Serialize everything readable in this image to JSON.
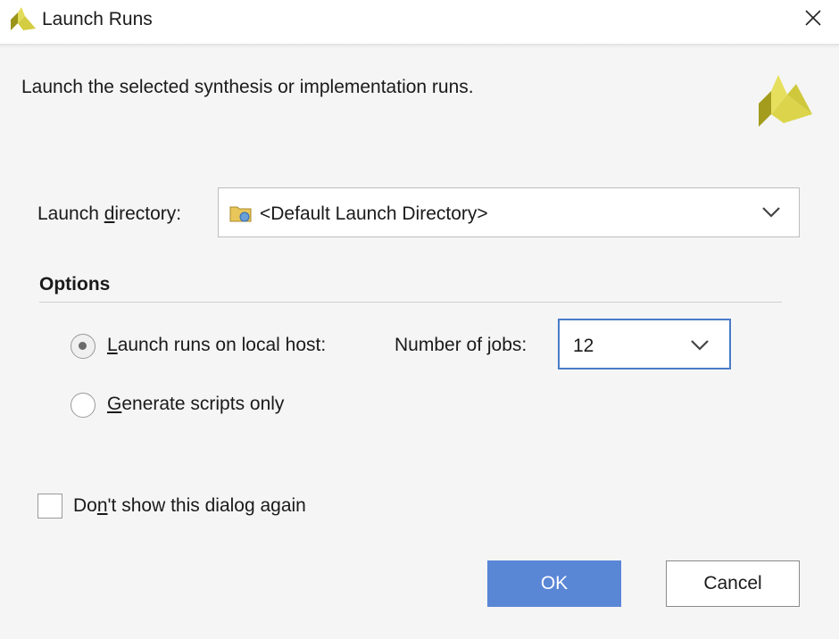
{
  "window": {
    "title": "Launch Runs",
    "close_icon": "close-x"
  },
  "description": "Launch the selected synthesis or implementation runs.",
  "launch_directory": {
    "label_pre": "Launch ",
    "label_mnemonic": "d",
    "label_post": "irectory:",
    "value": "<Default Launch Directory>",
    "icon": "folder-icon"
  },
  "options": {
    "title": "Options",
    "local_host": {
      "label_mnemonic": "L",
      "label_post": "aunch runs on local host:",
      "selected": true
    },
    "scripts_only": {
      "label_mnemonic": "G",
      "label_post": "enerate scripts only",
      "selected": false
    },
    "jobs": {
      "label_pre": "Number of ",
      "label_mnemonic": "j",
      "label_post": "obs:",
      "value": "12"
    }
  },
  "dont_show": {
    "label_pre": "Do",
    "label_mnemonic": "n",
    "label_post": "'t show this dialog again",
    "checked": false
  },
  "buttons": {
    "ok": "OK",
    "cancel": "Cancel"
  },
  "colors": {
    "accent": "#5a86d6",
    "focus_border": "#4a7bc8",
    "brand_gold": "#c9c23a"
  }
}
